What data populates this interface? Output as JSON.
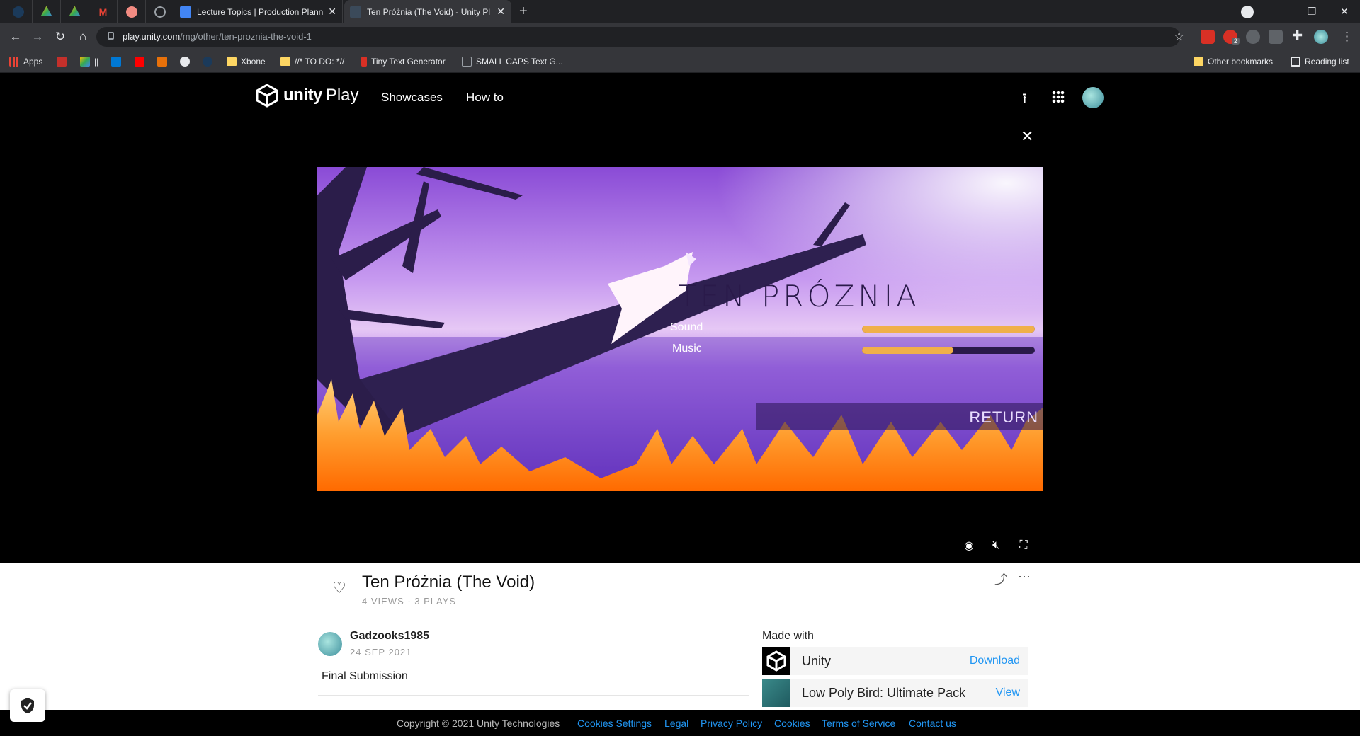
{
  "browser": {
    "tabs": [
      {
        "title": "Lecture Topics | Production Plann",
        "close": "✕"
      },
      {
        "title": "Ten Próżnia (The Void) - Unity Pl",
        "close": "✕"
      }
    ],
    "new_tab": "+",
    "url_domain": "play.unity.com",
    "url_path": "/mg/other/ten-proznia-the-void-1",
    "bookmarks": [
      {
        "label": "Apps"
      },
      {
        "label": "||"
      },
      {
        "label": "Xbone"
      },
      {
        "label": "//* TO DO: *//"
      },
      {
        "label": "Tiny Text Generator"
      },
      {
        "label": "SMALL CAPS Text G..."
      }
    ],
    "other_bookmarks": "Other bookmarks",
    "reading_list": "Reading list",
    "ext_badge": "2"
  },
  "site": {
    "logo_word": "unity",
    "logo_play": "Play",
    "nav": [
      "Showcases",
      "How to"
    ]
  },
  "game": {
    "title_text": "TEN PRÓZNIA",
    "sound_label": "Sound",
    "music_label": "Music",
    "sound_level": 1.0,
    "music_level": 0.53,
    "return_label": "RETURN"
  },
  "project": {
    "title": "Ten Próżnia (The Void)",
    "stats": "4 VIEWS · 3 PLAYS",
    "author": "Gadzooks1985",
    "date": "24 SEP 2021",
    "description": "Final Submission",
    "made_with_label": "Made with",
    "made_with": [
      {
        "name": "Unity",
        "action": "Download"
      },
      {
        "name": "Low Poly Bird: Ultimate Pack",
        "action": "View"
      }
    ]
  },
  "footer": {
    "copyright": "Copyright © 2021 Unity Technologies",
    "links": [
      "Cookies Settings",
      "Legal",
      "Privacy Policy",
      "Cookies",
      "Terms of Service",
      "Contact us"
    ]
  }
}
